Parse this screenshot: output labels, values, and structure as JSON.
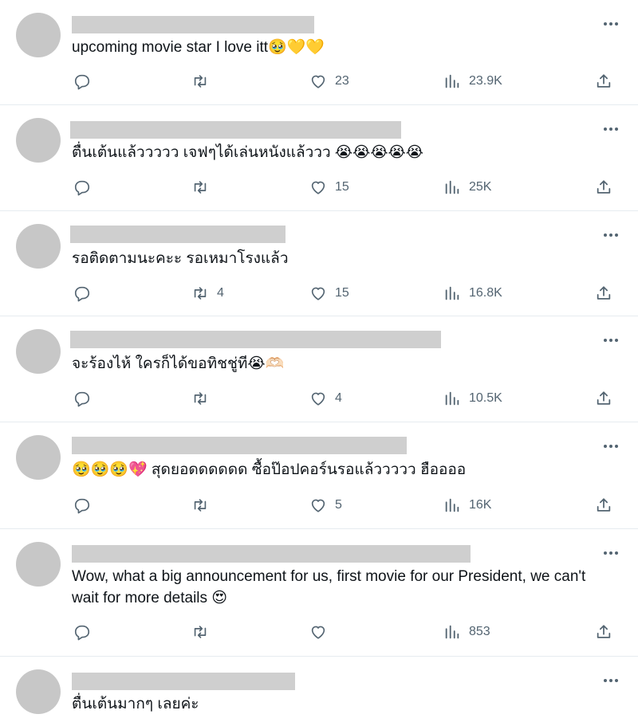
{
  "tweets": [
    {
      "text": "upcoming movie star I love itt🥹💛💛",
      "replies": "",
      "retweets": "",
      "likes": "23",
      "views": "23.9K"
    },
    {
      "text": "ตื่นเต้นแล้ววววว เจฟๆได้เล่นหนังแล้ววว 😭😭😭😭😭",
      "replies": "",
      "retweets": "",
      "likes": "15",
      "views": "25K"
    },
    {
      "text": "รอติดตามนะคะะ รอเหมาโรงแล้ว",
      "replies": "",
      "retweets": "4",
      "likes": "15",
      "views": "16.8K"
    },
    {
      "text": "จะร้องไห้ ใครก็ได้ขอทิชชู่ที😭🫶🏻",
      "replies": "",
      "retweets": "",
      "likes": "4",
      "views": "10.5K"
    },
    {
      "text": "🥹🥹🥹💖 สุดยอดดดดดด ซื้อป๊อปคอร์นรอแล้ววววว ฮืออออ",
      "replies": "",
      "retweets": "",
      "likes": "5",
      "views": "16K"
    },
    {
      "text": "Wow, what a big announcement for us, first movie for our President, we can't wait for more details 😍",
      "replies": "",
      "retweets": "",
      "likes": "",
      "views": "853"
    },
    {
      "text": "ตื่นเต้นมากๆ เลยค่ะ"
    }
  ],
  "icons": {
    "reply": "reply-icon",
    "retweet": "retweet-icon",
    "like": "heart-icon",
    "views": "views-icon",
    "share": "share-icon",
    "more": "more-icon"
  },
  "colors": {
    "icon": "#536471",
    "text": "#0f1419",
    "divider": "#e6ecf0",
    "redacted": "#cfcfcf",
    "avatar": "#c7c7c7"
  }
}
